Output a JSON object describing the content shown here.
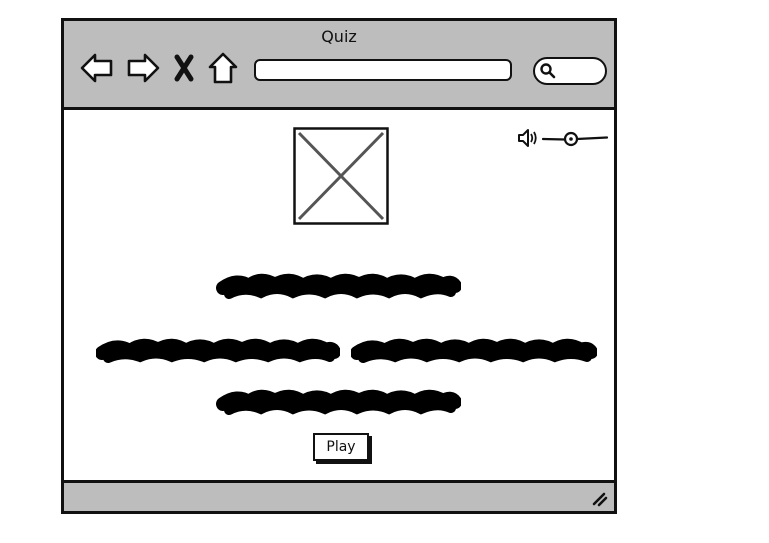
{
  "window": {
    "title": "Quiz"
  },
  "toolbar": {
    "back_icon": "arrow-left-icon",
    "forward_icon": "arrow-right-icon",
    "close_icon": "close-x-icon",
    "home_icon": "home-icon",
    "url_value": "",
    "search_icon": "magnifier-icon"
  },
  "content": {
    "image": "image-placeholder",
    "volume_icon": "speaker-icon",
    "volume_level": 0.5,
    "play_label": "Play"
  },
  "colors": {
    "chrome": "#bdbdbd",
    "ink": "#111111",
    "background": "#ffffff"
  }
}
